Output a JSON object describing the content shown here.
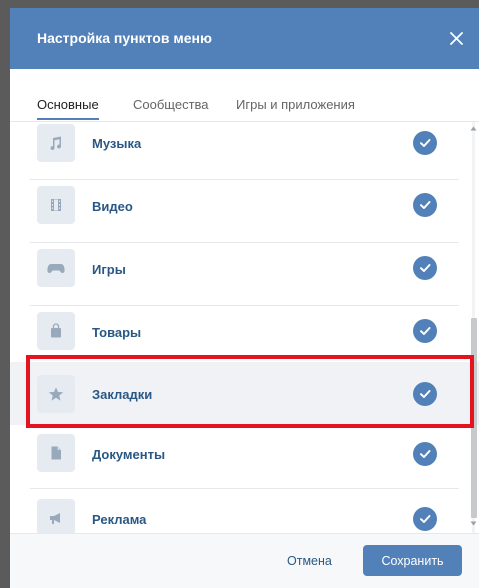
{
  "dialog": {
    "title": "Настройка пунктов меню",
    "close_icon": "close-icon"
  },
  "tabs": [
    {
      "label": "Основные",
      "active": true
    },
    {
      "label": "Сообщества",
      "active": false
    },
    {
      "label": "Игры и приложения",
      "active": false
    }
  ],
  "items": [
    {
      "label": "Музыка",
      "icon": "music-icon",
      "checked": true
    },
    {
      "label": "Видео",
      "icon": "video-icon",
      "checked": true
    },
    {
      "label": "Игры",
      "icon": "gamepad-icon",
      "checked": true
    },
    {
      "label": "Товары",
      "icon": "bag-icon",
      "checked": true
    },
    {
      "label": "Закладки",
      "icon": "star-icon",
      "checked": true
    },
    {
      "label": "Документы",
      "icon": "document-icon",
      "checked": true
    },
    {
      "label": "Реклама",
      "icon": "megaphone-icon",
      "checked": true
    }
  ],
  "footer": {
    "cancel_label": "Отмена",
    "save_label": "Сохранить"
  },
  "colors": {
    "accent": "#5181b8",
    "link": "#2a5885",
    "highlight_frame": "#e3141f"
  }
}
